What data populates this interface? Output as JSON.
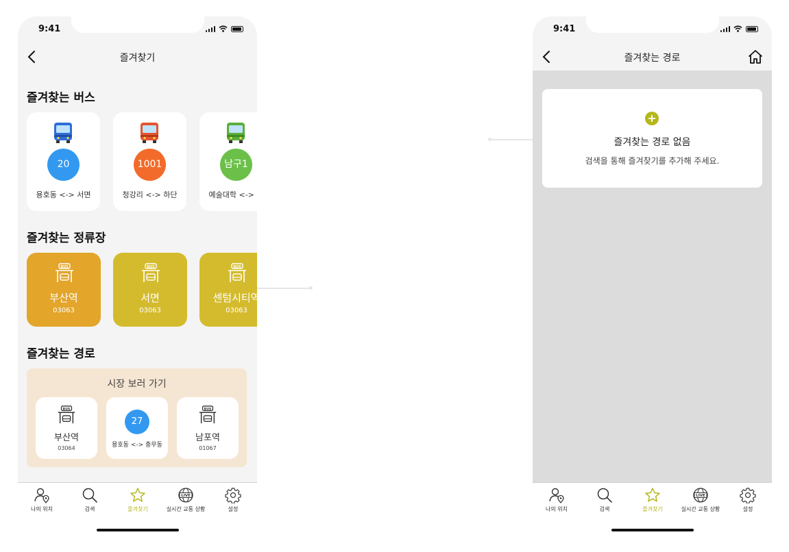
{
  "status": {
    "time": "9:41"
  },
  "left_screen": {
    "title": "즐겨찾기",
    "bus_section": {
      "title": "즐겨찾는 버스",
      "items": [
        {
          "number": "20",
          "route": "용호동 <-> 서면",
          "color": "#3399f0",
          "icon_color": "#2f6fd6",
          "icon": "bus-icon"
        },
        {
          "number": "1001",
          "route": "청강리 <-> 하단",
          "color": "#f26b2a",
          "icon_color": "#e5552d",
          "icon": "bus-icon"
        },
        {
          "number": "남구1",
          "route": "예술대학 <-> 청",
          "color": "#6cc04a",
          "icon_color": "#5aae3a",
          "icon": "bus-icon"
        }
      ]
    },
    "stop_section": {
      "title": "즐겨찾는 정류장",
      "items": [
        {
          "name": "부산역",
          "code": "03063",
          "color": "#e3a52a",
          "icon": "bus-stop-icon"
        },
        {
          "name": "서면",
          "code": "03063",
          "color": "#d4bb2d",
          "icon": "bus-stop-icon"
        },
        {
          "name": "센텀시티역",
          "code": "03063",
          "color": "#d4bb2d",
          "icon": "bus-stop-icon"
        }
      ]
    },
    "route_section": {
      "title": "즐겨찾는 경로",
      "route_name": "시장 보러 가기",
      "steps": [
        {
          "type": "stop",
          "name": "부산역",
          "code": "03064"
        },
        {
          "type": "bus",
          "number": "27",
          "route": "용호동 <-> 충무동"
        },
        {
          "type": "stop",
          "name": "남포역",
          "code": "01067"
        }
      ]
    }
  },
  "right_screen": {
    "title": "즐겨찾는 경로",
    "empty": {
      "title": "즐겨찾는 경로 없음",
      "description": "검색을 통해 즐겨찾기를 추가해 주세요.",
      "accent": "#b5b81a"
    }
  },
  "tabs": [
    {
      "label": "나의 위치",
      "icon": "person-location-icon",
      "active": false
    },
    {
      "label": "검색",
      "icon": "search-icon",
      "active": false
    },
    {
      "label": "즐겨찾기",
      "icon": "star-icon",
      "active": true
    },
    {
      "label": "실시간 교통 상황",
      "icon": "live-globe-icon",
      "active": false
    },
    {
      "label": "설정",
      "icon": "gear-icon",
      "active": false
    }
  ]
}
